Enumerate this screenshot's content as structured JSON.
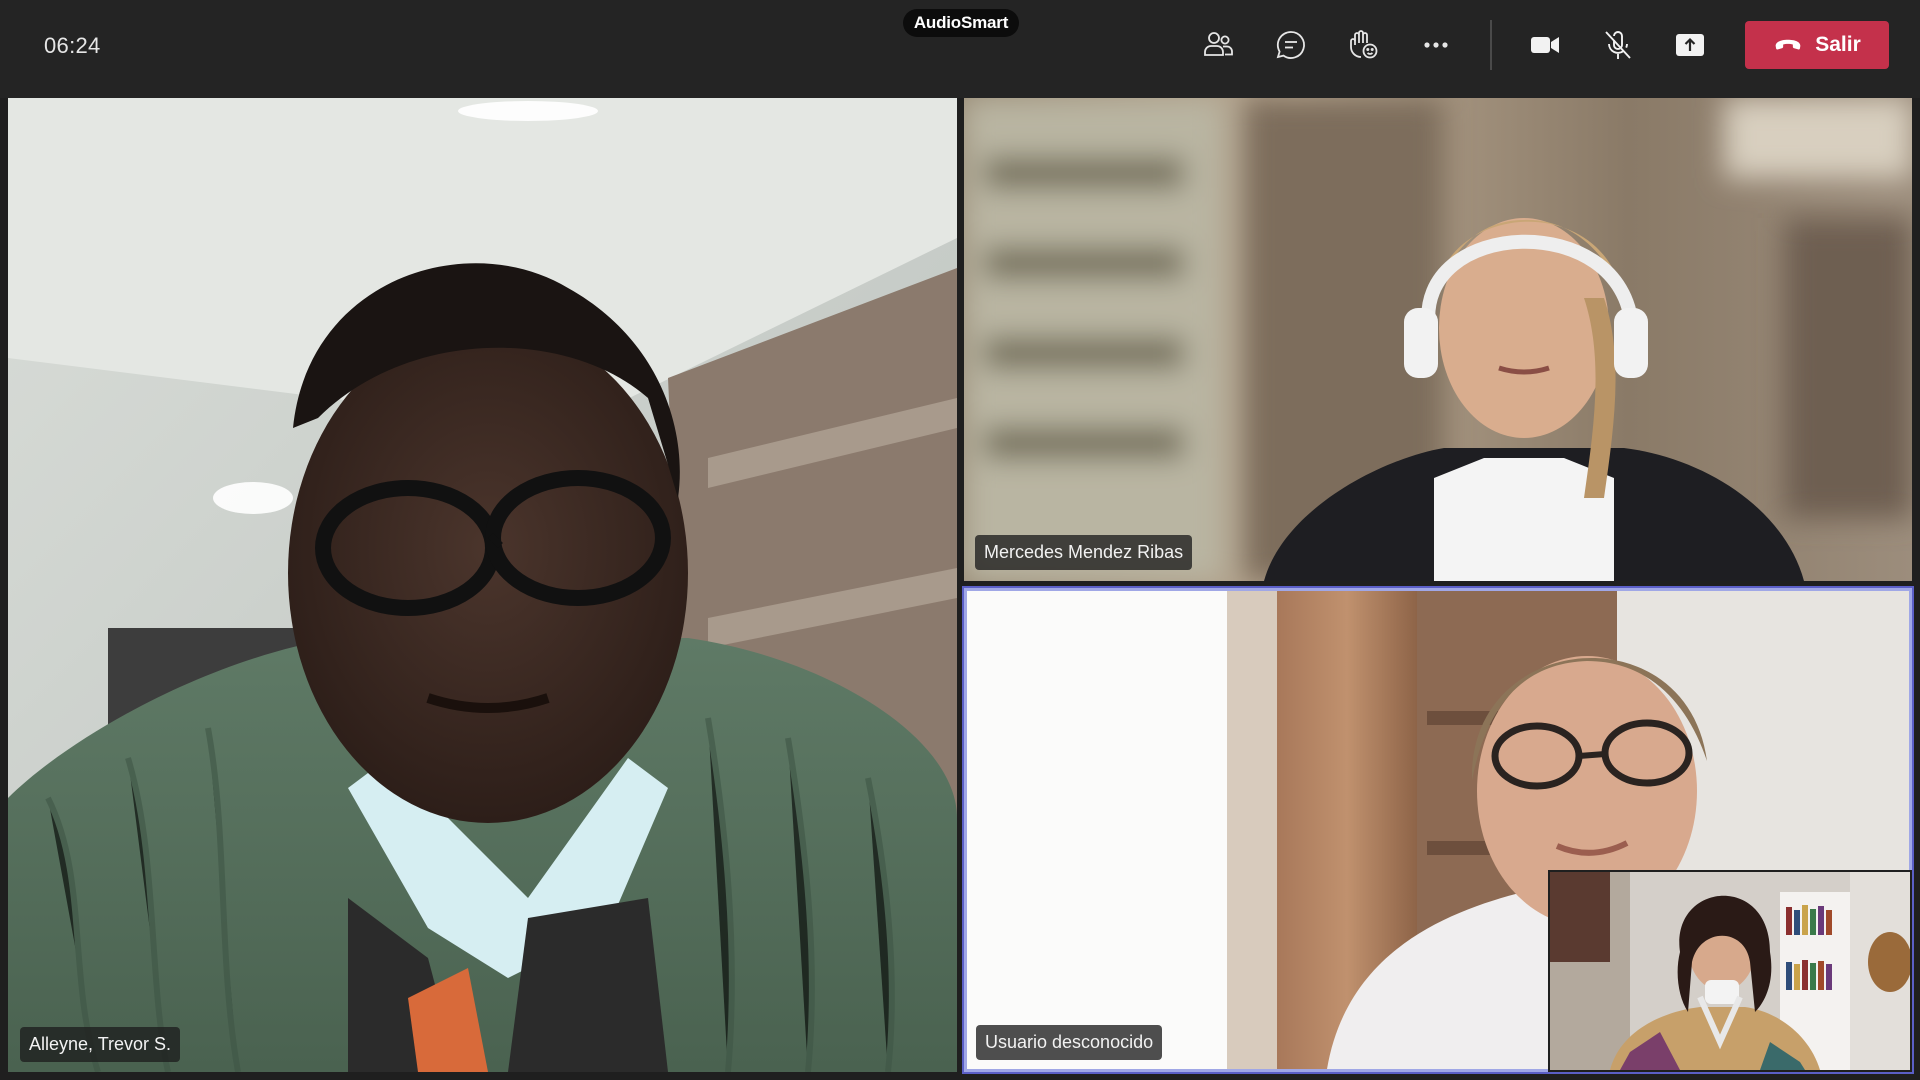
{
  "meeting": {
    "timer": "06:24",
    "logo_text": "AudioSmart",
    "leave_label": "Salir"
  },
  "toolbar": {
    "icons": [
      "participants-icon",
      "chat-icon",
      "raise-hand-icon",
      "more-options-icon",
      "camera-icon",
      "mic-off-icon",
      "share-screen-icon",
      "phone-hangup-icon"
    ]
  },
  "participants": {
    "main": {
      "name": "Alleyne, Trevor S."
    },
    "top_right": {
      "name": "Mercedes Mendez Ribas"
    },
    "bottom_right": {
      "name": "Usuario desconocido"
    }
  },
  "colors": {
    "leave_button": "#c4314b",
    "active_speaker_border": "#a0a7e6",
    "topbar": "#242424"
  }
}
